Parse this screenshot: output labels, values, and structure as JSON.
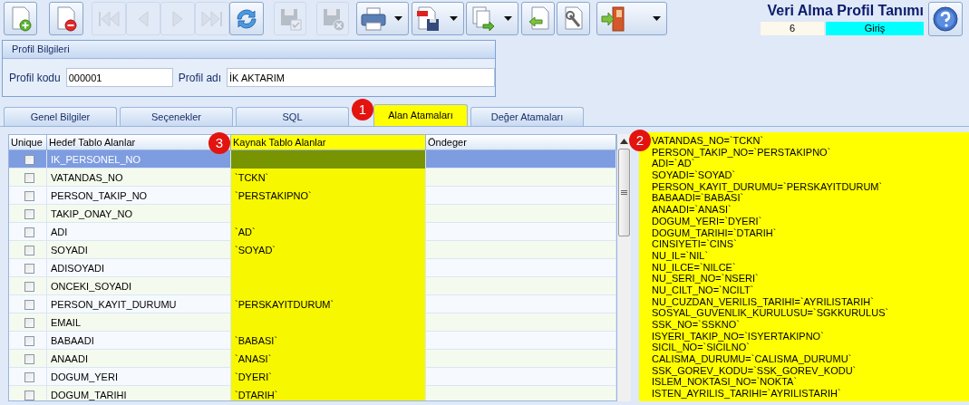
{
  "toolbar": [
    {
      "disabled": false,
      "dropdown": false
    },
    {
      "disabled": false,
      "dropdown": false
    },
    {
      "disabled": true,
      "dropdown": false
    },
    {
      "disabled": true,
      "dropdown": false
    },
    {
      "disabled": true,
      "dropdown": false
    },
    {
      "disabled": true,
      "dropdown": false
    },
    {
      "disabled": false,
      "dropdown": false
    },
    {
      "disabled": true,
      "dropdown": false
    },
    {
      "disabled": true,
      "dropdown": false
    },
    {
      "disabled": false,
      "dropdown": true
    },
    {
      "disabled": false,
      "dropdown": true
    },
    {
      "disabled": false,
      "dropdown": true
    },
    {
      "disabled": false,
      "dropdown": false
    },
    {
      "disabled": false,
      "dropdown": false
    },
    {
      "disabled": false,
      "dropdown": true
    }
  ],
  "header": {
    "title": "Veri Alma Profil Tanımı",
    "record": "6",
    "mode": "Giriş"
  },
  "profile_panel": {
    "title": "Profil Bilgileri",
    "fields": [
      {
        "label": "Profil kodu",
        "value": "000001"
      },
      {
        "label": "Profil adı",
        "value": "İK AKTARIM"
      }
    ]
  },
  "tabs": [
    {
      "label": "Genel Bilgiler",
      "selected": false
    },
    {
      "label": "Seçenekler",
      "selected": false
    },
    {
      "label": "SQL",
      "selected": false
    },
    {
      "label": "Alan Atamaları",
      "selected": true,
      "badge": "1"
    },
    {
      "label": "Değer Atamaları",
      "selected": false
    }
  ],
  "table": {
    "columns": [
      {
        "label": "Unique",
        "highlighted": false
      },
      {
        "label": "Hedef Tablo Alanlar",
        "highlighted": false
      },
      {
        "label": "Kaynak Tablo Alanlar",
        "highlighted": true,
        "badge": "3"
      },
      {
        "label": "Öndeger",
        "highlighted": false
      }
    ],
    "rows": [
      {
        "unique": false,
        "target": "IK_PERSONEL_NO",
        "source": "",
        "selected": true
      },
      {
        "unique": false,
        "target": "VATANDAS_NO",
        "source": "`TCKN`",
        "selected": false
      },
      {
        "unique": false,
        "target": "PERSON_TAKIP_NO",
        "source": "`PERSTAKIPNO`",
        "selected": false
      },
      {
        "unique": false,
        "target": "TAKIP_ONAY_NO",
        "source": "",
        "selected": false
      },
      {
        "unique": false,
        "target": "ADI",
        "source": "`AD`",
        "selected": false
      },
      {
        "unique": false,
        "target": "SOYADI",
        "source": "`SOYAD`",
        "selected": false
      },
      {
        "unique": false,
        "target": "ADISOYADI",
        "source": "",
        "selected": false
      },
      {
        "unique": false,
        "target": "ONCEKI_SOYADI",
        "source": "",
        "selected": false
      },
      {
        "unique": false,
        "target": "PERSON_KAYIT_DURUMU",
        "source": "`PERSKAYITDURUM`",
        "selected": false
      },
      {
        "unique": false,
        "target": "EMAIL",
        "source": "",
        "selected": false
      },
      {
        "unique": false,
        "target": "BABAADI",
        "source": "`BABASI`",
        "selected": false
      },
      {
        "unique": false,
        "target": "ANAADI",
        "source": "`ANASI`",
        "selected": false
      },
      {
        "unique": false,
        "target": "DOGUM_YERI",
        "source": "`DYERI`",
        "selected": false
      },
      {
        "unique": false,
        "target": "DOGUM_TARIHI",
        "source": "`DTARIH`",
        "selected": false
      }
    ]
  },
  "mapping_text": {
    "badge": "2",
    "lines": [
      "VATANDAS_NO=`TCKN`",
      "PERSON_TAKIP_NO=`PERSTAKIPNO`",
      "ADI=`AD`",
      "SOYADI=`SOYAD`",
      "PERSON_KAYIT_DURUMU=`PERSKAYITDURUM`",
      "BABAADI=`BABASI`",
      "ANAADI=`ANASI`",
      "DOGUM_YERI=`DYERI`",
      "DOGUM_TARIHI=`DTARIH`",
      "CINSIYETI=`CINS`",
      "NU_IL=`NIL`",
      "NU_ILCE=`NILCE`",
      "NU_SERI_NO=`NSERI`",
      "NU_CILT_NO=`NCILT`",
      "NU_CUZDAN_VERILIS_TARIHI=`AYRILISTARIH`",
      "SOSYAL_GUVENLIK_KURULUSU=`SGKKURULUS`",
      "SSK_NO=`SSKNO`",
      "ISYERI_TAKIP_NO=`ISYERTAKIPNO`",
      "SICIL_NO=`SICILNO`",
      "CALISMA_DURUMU=`CALISMA_DURUMU`",
      "SSK_GOREV_KODU=`SSK_GOREV_KODU`",
      "ISLEM_NOKTASI_NO=`NOKTA`",
      "ISTEN_AYRILIS_TARIHI=`AYRILISTARIH`"
    ]
  }
}
